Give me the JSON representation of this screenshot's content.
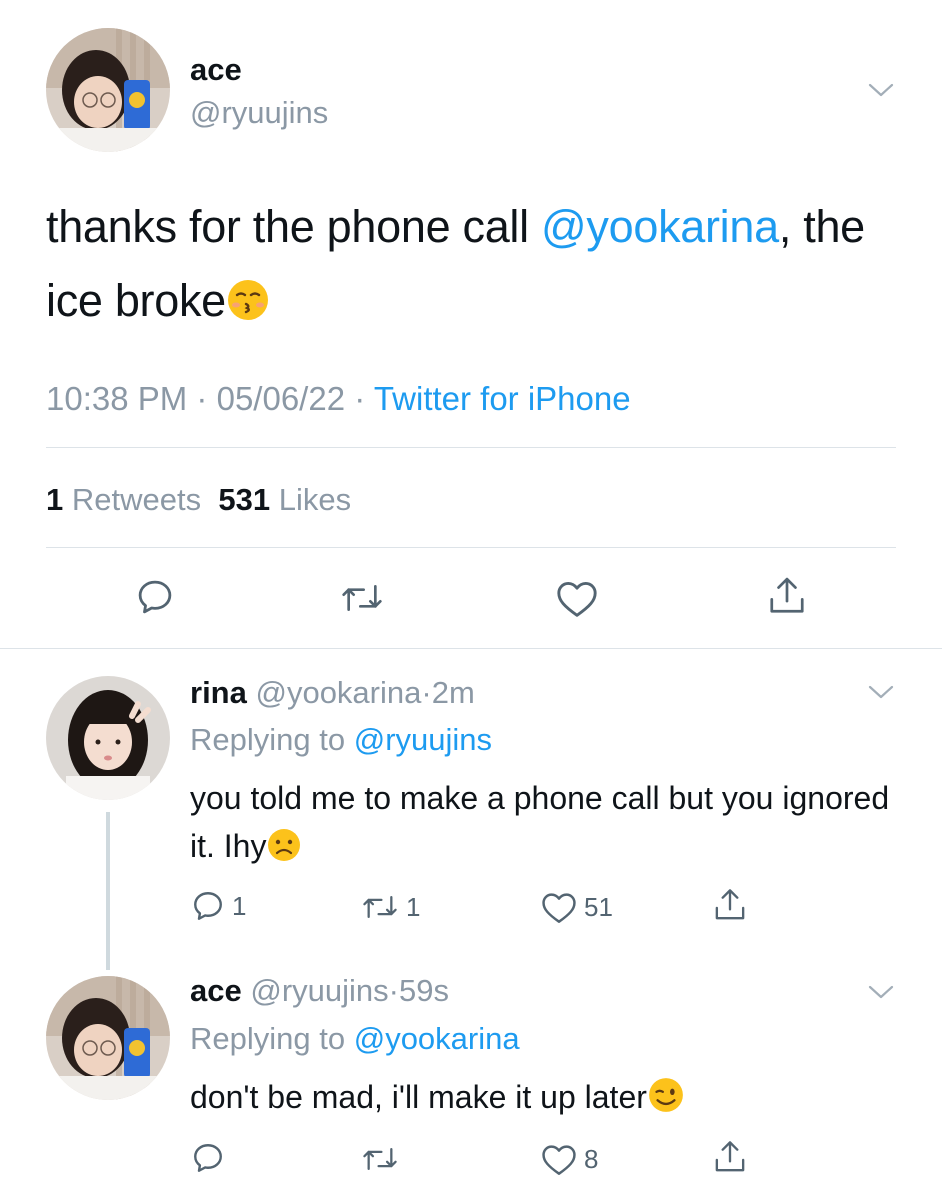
{
  "main_tweet": {
    "name": "ace",
    "handle": "@ryuujins",
    "text_before": "thanks for the phone call ",
    "mention": "@yookarina",
    "text_after": ", the ice broke",
    "emoji": "kissing-closed-eyes-emoji",
    "time": "10:38 PM",
    "date": "05/06/22",
    "source": "Twitter for iPhone",
    "retweets_count": "1",
    "retweets_label": "Retweets",
    "likes_count": "531",
    "likes_label": "Likes"
  },
  "replies": [
    {
      "name": "rina",
      "handle": "@yookarina",
      "time": "2m",
      "replying_label": "Replying to",
      "replying_to": "@ryuujins",
      "text": "you told me to make a phone call but you ignored it. Ihy",
      "emoji": "frowning-emoji",
      "reply_count": "1",
      "retweet_count": "1",
      "like_count": "51"
    },
    {
      "name": "ace",
      "handle": "@ryuujins",
      "time": "59s",
      "replying_label": "Replying to",
      "replying_to": "@yookarina",
      "text": "don't be mad, i'll make it up later",
      "emoji": "winking-emoji",
      "reply_count": "",
      "retweet_count": "",
      "like_count": "8"
    }
  ],
  "separator": "·",
  "colors": {
    "link": "#1d9bf0",
    "muted": "#8b98a5",
    "text": "#0f1419",
    "divider": "#dde3e8",
    "thread_line": "#cfd9de"
  }
}
